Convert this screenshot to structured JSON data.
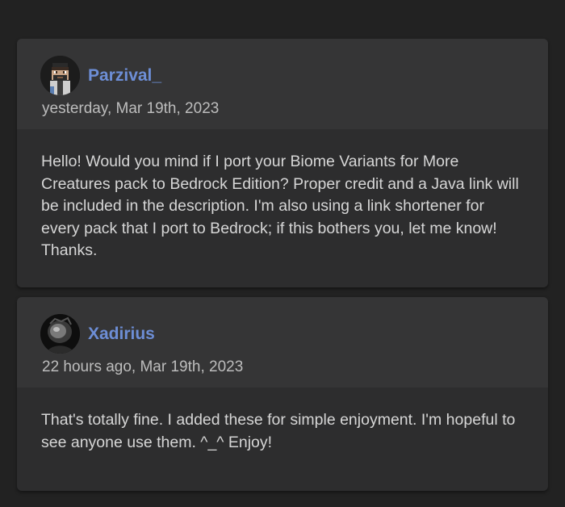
{
  "comments": [
    {
      "username": "Parzival_",
      "timestamp": "yesterday, Mar 19th, 2023",
      "avatar_icon": "pixel-character-avatar",
      "body": "Hello! Would you mind if I port your Biome Variants for More Creatures pack to Bedrock Edition? Proper credit and a Java link will be included in the description. I'm also using a link shortener for every pack that I port to Bedrock; if this bothers you, let me know! Thanks."
    },
    {
      "username": "Xadirius",
      "timestamp": "22 hours ago, Mar 19th, 2023",
      "avatar_icon": "dark-portrait-avatar",
      "body": "That's totally fine. I added these for simple enjoyment. I'm hopeful to see anyone use them. ^_^ Enjoy!"
    }
  ],
  "colors": {
    "background": "#222222",
    "card": "#2d2d2e",
    "card_header": "#353536",
    "username": "#6d8ed6",
    "text": "#d6d6d6",
    "muted": "#bdbdbd"
  }
}
